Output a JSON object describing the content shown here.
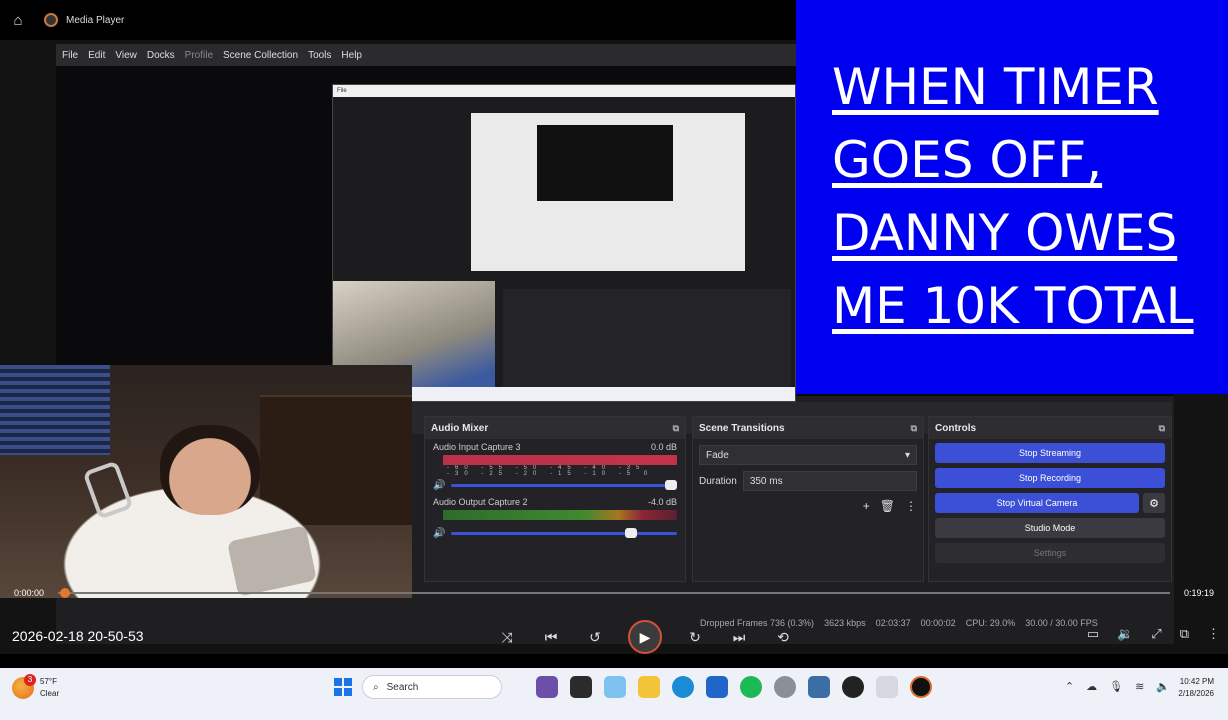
{
  "media_player": {
    "title": "Media Player"
  },
  "obs": {
    "menu": [
      "File",
      "Edit",
      "View",
      "Docks",
      "Profile",
      "Scene Collection",
      "Tools",
      "Help"
    ],
    "audio_mixer": {
      "title": "Audio Mixer",
      "tracks": [
        {
          "name": "Audio Input Capture 3",
          "level": "0.0 dB"
        },
        {
          "name": "Audio Output Capture 2",
          "level": "-4.0 dB"
        }
      ],
      "scale": [
        "-60",
        "-55",
        "-50",
        "-45",
        "-40",
        "-35",
        "-30",
        "-25",
        "-20",
        "-15",
        "-10",
        "-5",
        "0"
      ]
    },
    "scene_transitions": {
      "title": "Scene Transitions",
      "selected": "Fade",
      "duration_label": "Duration",
      "duration_value": "350 ms"
    },
    "controls": {
      "title": "Controls",
      "stop_streaming": "Stop Streaming",
      "stop_recording": "Stop Recording",
      "stop_virtual_camera": "Stop Virtual Camera",
      "studio_mode": "Studio Mode",
      "settings": "Settings"
    },
    "status": {
      "dropped_frames": "Dropped Frames 736 (0.3%)",
      "bitrate": "3623 kbps",
      "stream_time": "02:03:37",
      "rec_time": "00:00:02",
      "cpu": "CPU: 29.0%",
      "fps": "30.00 / 30.00 FPS"
    }
  },
  "meme": {
    "lines": [
      "WHEN TIMER",
      "GOES OFF,",
      "DANNY OWES",
      "ME 10K TOTAL"
    ]
  },
  "player": {
    "time_current": "0:00:00",
    "time_total": "0:19:19",
    "video_title": "2026-02-18 20-50-53"
  },
  "taskbar": {
    "weather_temp": "57°F",
    "weather_cond": "Clear",
    "weather_badge": "3",
    "search": "Search",
    "time": "10:42 PM",
    "date": "2/18/2026"
  }
}
